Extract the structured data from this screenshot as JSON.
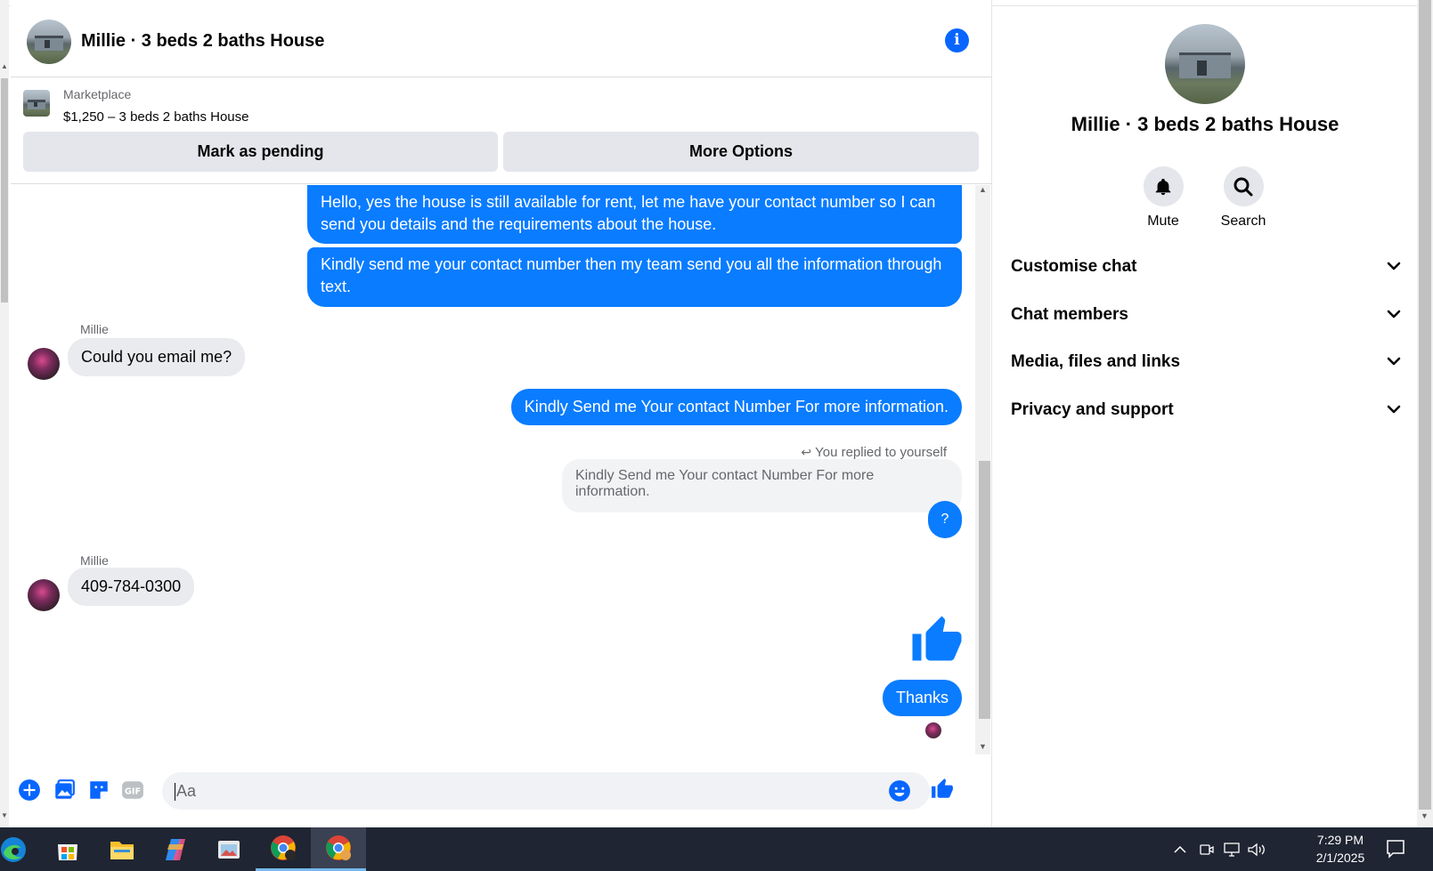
{
  "header": {
    "title": "Millie · 3 beds 2 baths House"
  },
  "marketplace": {
    "label": "Marketplace",
    "listing": "$1,250 – 3 beds 2 baths House",
    "pending_button": "Mark as pending",
    "more_button": "More Options"
  },
  "messages": {
    "out_1": "Hello, yes the house is still available for rent, let me have your contact number so I can send you details and the requirements about the house.",
    "out_2": "Kindly send me your contact number then my team send you all the information through text.",
    "sender_1": "Millie",
    "in_1": "Could you email me?",
    "out_3": "Kindly Send me Your contact Number For more information.",
    "replied_label": "You replied to yourself",
    "quoted": "Kindly Send me Your contact Number For more information.",
    "reply": "?",
    "sender_2": "Millie",
    "in_2": "409-784-0300",
    "out_4": "Thanks"
  },
  "composer": {
    "placeholder": "Aa"
  },
  "right_panel": {
    "title": "Millie · 3 beds 2 baths House",
    "mute_label": "Mute",
    "search_label": "Search",
    "sections": [
      "Customise chat",
      "Chat members",
      "Media, files and links",
      "Privacy and support"
    ]
  },
  "taskbar": {
    "time": "7:29 PM",
    "date": "2/1/2025"
  },
  "colors": {
    "accent": "#0866ff",
    "outgoing_bubble": "#0a7cff",
    "incoming_bubble": "#e9ebee",
    "taskbar": "#1f2532"
  }
}
